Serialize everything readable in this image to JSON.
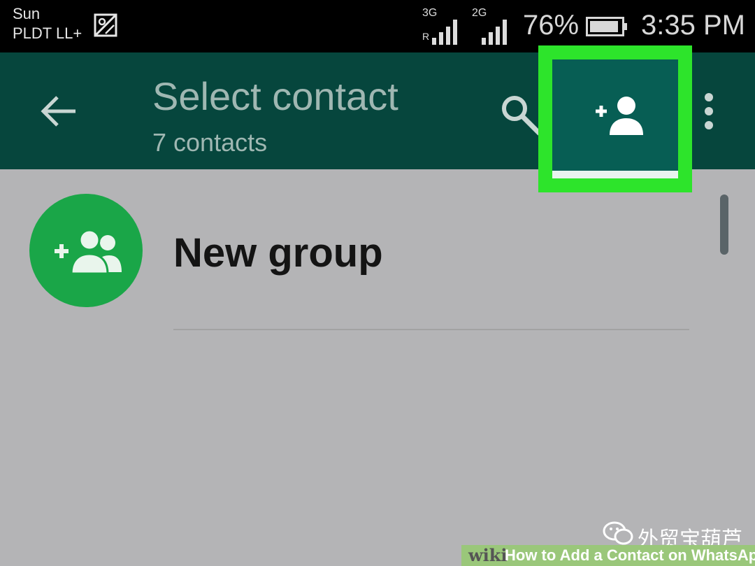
{
  "status_bar": {
    "carrier_line1": "Sun",
    "carrier_line2": "PLDT LL+",
    "net1": "3G",
    "net1_roaming": "R",
    "net2": "2G",
    "battery_percent": "76%",
    "time": "3:35 PM"
  },
  "app_bar": {
    "title": "Select contact",
    "subtitle": "7 contacts",
    "icons": [
      "arrow-left-icon",
      "search-icon",
      "add-contact-icon",
      "more-vert-icon"
    ],
    "highlight_color": "#2de42b"
  },
  "list": {
    "items": [
      {
        "label": "New group",
        "icon": "group-add-icon"
      }
    ]
  },
  "watermark": {
    "wechat_text": "外贸宝葫芦",
    "wiki": "wiki",
    "howto_text": "How to Add a Contact on WhatsApp"
  },
  "colors": {
    "app_bar": "#06463d",
    "avatar": "#1aa648",
    "background": "#b4b4b6"
  }
}
